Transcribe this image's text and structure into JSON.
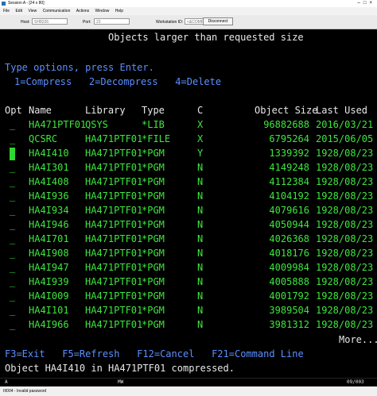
{
  "window": {
    "title": "Session A - [24 x 80]"
  },
  "menu": [
    "File",
    "Edit",
    "View",
    "Communication",
    "Actions",
    "Window",
    "Help"
  ],
  "toolbar": {
    "host_label": "Host:",
    "host_value": "SH8226",
    "port_label": "Port:",
    "port_value": "23",
    "workstation_label": "Workstation ID:",
    "workstation_value": "<&COMPA>",
    "disconnect_label": "Disconnect"
  },
  "screen": {
    "title": "Objects larger than requested size",
    "instruction": "Type options, press Enter.",
    "options": "1=Compress   2=Decompress   4=Delete",
    "headers": {
      "opt": "Opt",
      "name": "Name",
      "library": "Library",
      "type": "Type",
      "c": "C",
      "size": "Object Size",
      "last_used": "Last Used"
    },
    "rows": [
      {
        "opt": "_",
        "name": "HA471PTF01",
        "library": "QSYS",
        "type": "*LIB",
        "c": "X",
        "size": "96882688",
        "last_used": "2016/03/21"
      },
      {
        "opt": "_",
        "name": "QCSRC",
        "library": "HA471PTF01",
        "type": "*FILE",
        "c": "X",
        "size": "6795264",
        "last_used": "2015/06/05"
      },
      {
        "opt": "",
        "name": "HA4I410",
        "library": "HA471PTF01",
        "type": "*PGM",
        "c": "Y",
        "size": "1339392",
        "last_used": "1928/08/23"
      },
      {
        "opt": "_",
        "name": "HA4I301",
        "library": "HA471PTF01",
        "type": "*PGM",
        "c": "N",
        "size": "4149248",
        "last_used": "1928/08/23"
      },
      {
        "opt": "_",
        "name": "HA4I408",
        "library": "HA471PTF01",
        "type": "*PGM",
        "c": "N",
        "size": "4112384",
        "last_used": "1928/08/23"
      },
      {
        "opt": "_",
        "name": "HA4I936",
        "library": "HA471PTF01",
        "type": "*PGM",
        "c": "N",
        "size": "4104192",
        "last_used": "1928/08/23"
      },
      {
        "opt": "_",
        "name": "HA4I934",
        "library": "HA471PTF01",
        "type": "*PGM",
        "c": "N",
        "size": "4079616",
        "last_used": "1928/08/23"
      },
      {
        "opt": "_",
        "name": "HA4I946",
        "library": "HA471PTF01",
        "type": "*PGM",
        "c": "N",
        "size": "4050944",
        "last_used": "1928/08/23"
      },
      {
        "opt": "_",
        "name": "HA4I701",
        "library": "HA471PTF01",
        "type": "*PGM",
        "c": "N",
        "size": "4026368",
        "last_used": "1928/08/23"
      },
      {
        "opt": "_",
        "name": "HA4I908",
        "library": "HA471PTF01",
        "type": "*PGM",
        "c": "N",
        "size": "4018176",
        "last_used": "1928/08/23"
      },
      {
        "opt": "_",
        "name": "HA4I947",
        "library": "HA471PTF01",
        "type": "*PGM",
        "c": "N",
        "size": "4009984",
        "last_used": "1928/08/23"
      },
      {
        "opt": "_",
        "name": "HA4I939",
        "library": "HA471PTF01",
        "type": "*PGM",
        "c": "N",
        "size": "4005888",
        "last_used": "1928/08/23"
      },
      {
        "opt": "_",
        "name": "HA4I009",
        "library": "HA471PTF01",
        "type": "*PGM",
        "c": "N",
        "size": "4001792",
        "last_used": "1928/08/23"
      },
      {
        "opt": "_",
        "name": "HA4I101",
        "library": "HA471PTF01",
        "type": "*PGM",
        "c": "N",
        "size": "3989504",
        "last_used": "1928/08/23"
      },
      {
        "opt": "_",
        "name": "HA4I966",
        "library": "HA471PTF01",
        "type": "*PGM",
        "c": "N",
        "size": "3981312",
        "last_used": "1928/08/23"
      }
    ],
    "more": "More...",
    "function_keys": "F3=Exit   F5=Refresh   F12=Cancel   F21=Command Line",
    "message": "Object HA4I410 in HA471PTF01 compressed."
  },
  "status_line": {
    "left": "A",
    "mid": "MW",
    "right": "09/003"
  },
  "bottom": {
    "text": "III004 - Invalid password"
  },
  "colors": {
    "text_white": "#e8e8e8",
    "text_blue": "#5c8fff",
    "text_green": "#3ee63e",
    "cursor": "#2fd82f",
    "background": "#000000"
  }
}
